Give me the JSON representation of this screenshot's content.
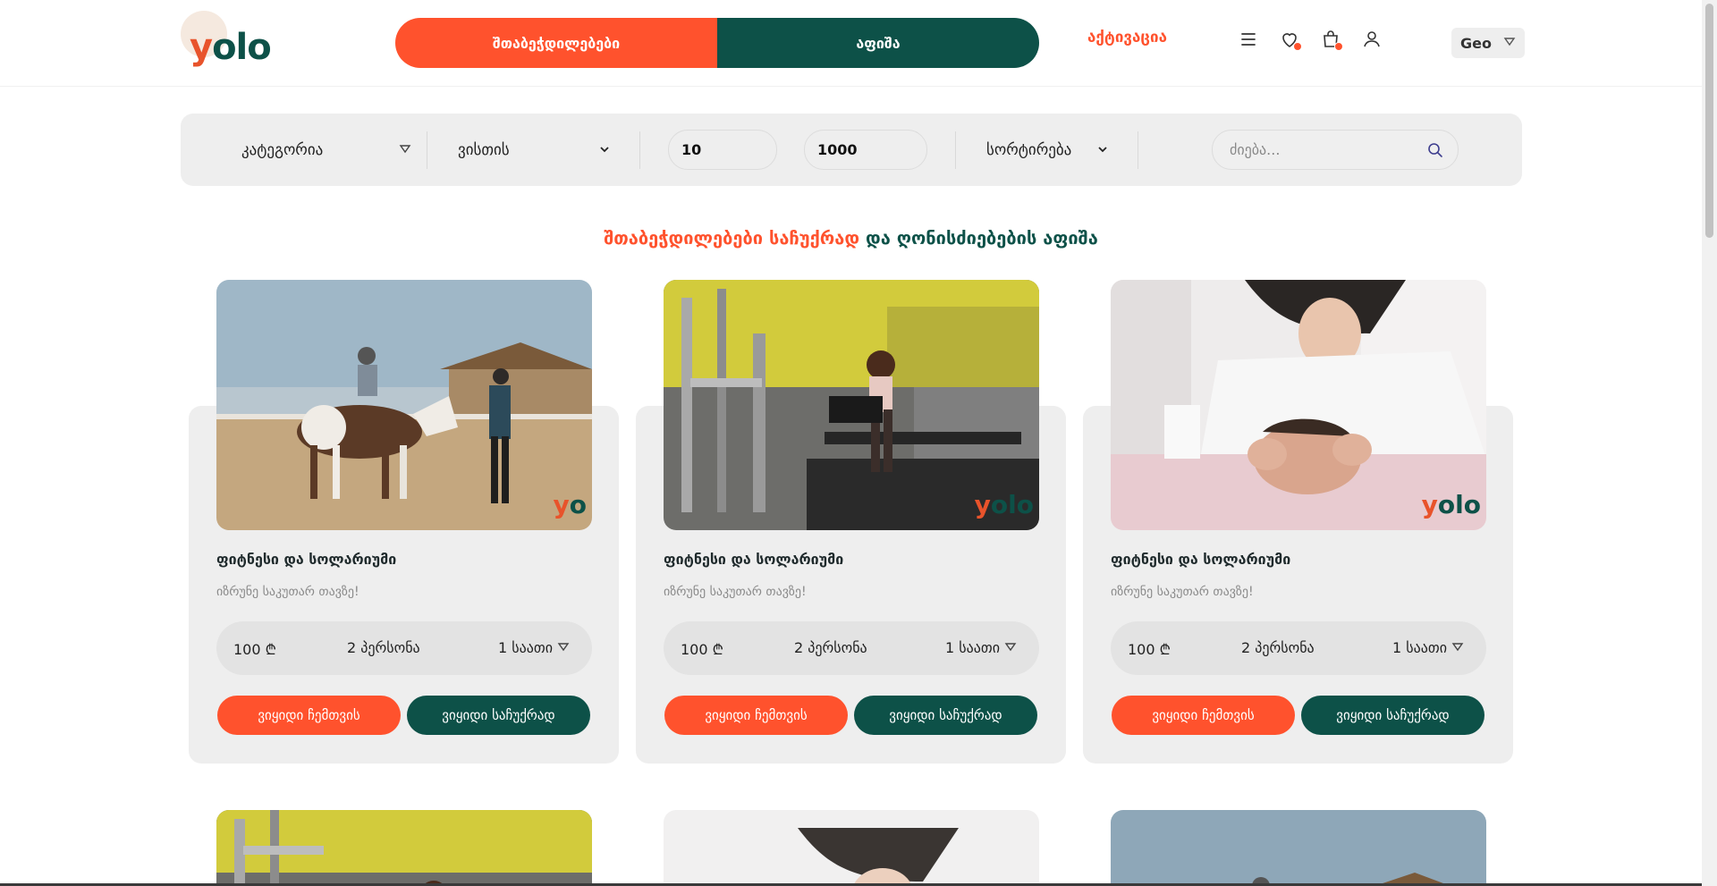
{
  "header": {
    "logo_text_y": "y",
    "logo_text_rest": "olo",
    "tabs": [
      "შთაბეჭდილებები",
      "აფიშა"
    ],
    "activation": "აქტივაცია",
    "lang": "Geo"
  },
  "filters": {
    "category": "კატეგორია",
    "for_whom": "ვისთის",
    "price_min": "10",
    "price_max": "1000",
    "sort": "სორტირება",
    "search_placeholder": "ძიება..."
  },
  "section_title": {
    "part1": "შთაბეჭდილებები საჩუქრად",
    "part2": "და ღონისძიებების აფიშა"
  },
  "cards": [
    {
      "title": "ფიტნესი და სოლარიუმი",
      "subtitle": "იზრუნე საკუთარ თავზე!",
      "price": "100 ₾",
      "persons": "2 პერსონა",
      "duration": "1 საათი",
      "btn_self": "ვიყიდი ჩემთვის",
      "btn_gift": "ვიყიდი საჩუქრად"
    },
    {
      "title": "ფიტნესი და სოლარიუმი",
      "subtitle": "იზრუნე საკუთარ თავზე!",
      "price": "100 ₾",
      "persons": "2 პერსონა",
      "duration": "1 საათი",
      "btn_self": "ვიყიდი ჩემთვის",
      "btn_gift": "ვიყიდი საჩუქრად"
    },
    {
      "title": "ფიტნესი და სოლარიუმი",
      "subtitle": "იზრუნე საკუთარ თავზე!",
      "price": "100 ₾",
      "persons": "2 პერსონა",
      "duration": "1 საათი",
      "btn_self": "ვიყიდი ჩემთვის",
      "btn_gift": "ვიყიდი საჩუქრად"
    }
  ],
  "colors": {
    "accent": "#ff522d",
    "brand_green": "#0d5148",
    "panel": "#eeeeee"
  },
  "icons": [
    "menu-icon",
    "heart-icon",
    "shopping-bag-icon",
    "user-icon",
    "chevron-down-icon",
    "search-icon"
  ]
}
